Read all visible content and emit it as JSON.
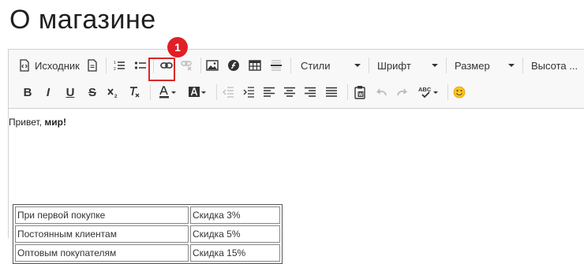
{
  "page": {
    "title": "О магазине"
  },
  "toolbar": {
    "source_label": "Исходник",
    "styles_label": "Стили",
    "font_label": "Шрифт",
    "size_label": "Размер",
    "height_label": "Высота ..."
  },
  "callout": {
    "number": "1",
    "color": "#e01f26"
  },
  "content": {
    "greeting_text": "Привет, ",
    "greeting_bold": "мир!",
    "table": {
      "rows": [
        [
          "При первой покупке",
          "Скидка 3%"
        ],
        [
          "Постоянным клиентам",
          "Скидка 5%"
        ],
        [
          "Оптовым покупателям",
          "Скидка 15%"
        ]
      ]
    }
  }
}
